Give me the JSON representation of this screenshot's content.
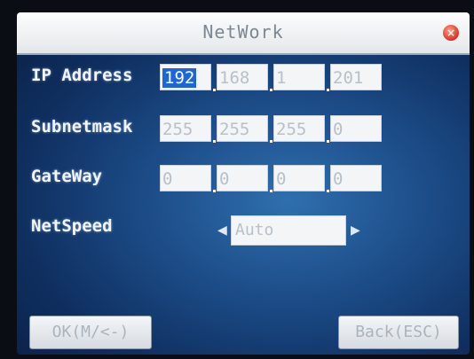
{
  "window": {
    "title": "NetWork",
    "close_icon": "close-icon"
  },
  "fields": {
    "ip_address": {
      "label": "IP Address",
      "octets": [
        "192",
        "168",
        "1",
        "201"
      ],
      "selected_octet": 0
    },
    "subnetmask": {
      "label": "Subnetmask",
      "octets": [
        "255",
        "255",
        "255",
        "0"
      ]
    },
    "gateway": {
      "label": "GateWay",
      "octets": [
        "0",
        "0",
        "0",
        "0"
      ]
    },
    "netspeed": {
      "label": "NetSpeed",
      "value": "Auto"
    }
  },
  "buttons": {
    "ok": "OK(M/<-)",
    "back": "Back(ESC)"
  },
  "colors": {
    "selection": "#1e66d8",
    "screen_bg": "#1d4e8a"
  }
}
